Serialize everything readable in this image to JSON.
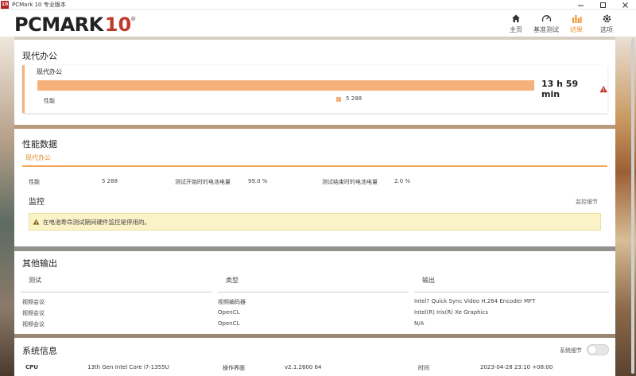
{
  "window": {
    "app_logo": "10",
    "title": "PCMark 10 专业版本",
    "min_icon": "minimize-icon",
    "max_icon": "maximize-icon",
    "close_icon": "close-icon"
  },
  "brand": {
    "name": "PCMARK",
    "number": "10",
    "reg": "®"
  },
  "nav": [
    {
      "label": "主页",
      "icon": "home-icon",
      "active": false
    },
    {
      "label": "基准测试",
      "icon": "gauge-icon",
      "active": false
    },
    {
      "label": "结果",
      "icon": "bar-chart-icon",
      "active": true
    },
    {
      "label": "选项",
      "icon": "gear-icon",
      "active": false
    }
  ],
  "colors": {
    "accent": "#f09a3e",
    "bar": "#f6b07a",
    "warning_red": "#c0392b",
    "alert_bg": "#fbf3c8"
  },
  "result": {
    "section_title": "现代办公",
    "name": "现代办公",
    "duration": "13 h 59 min",
    "perf_label": "性能",
    "perf_value": "5 288"
  },
  "performance": {
    "section_title": "性能数据",
    "tab": "现代办公",
    "items": [
      {
        "label": "性能",
        "value": "5 288"
      },
      {
        "label": "测试开始时的电池电量",
        "value": "99.0 %"
      },
      {
        "label": "测试结束时的电池电量",
        "value": "2.0 %"
      }
    ],
    "monitor_title": "监控",
    "monitor_link": "监控细节",
    "alert": "在电池寿命测试期间硬件监控是停用的。"
  },
  "other": {
    "section_title": "其他输出",
    "headers": [
      "测试",
      "类型",
      "输出"
    ],
    "rows": [
      [
        "视频会议",
        "视频编码器",
        "Intel? Quick Sync Video H.264 Encoder MFT"
      ],
      [
        "视频会议",
        "OpenCL",
        "Intel(R) Iris(R) Xe Graphics"
      ],
      [
        "视频会议",
        "OpenCL",
        "N/A"
      ]
    ]
  },
  "sysinfo": {
    "section_title": "系统信息",
    "detail_label": "系统细节",
    "detail_on": false,
    "cpu_label": "CPU",
    "cpu_value": "13th Gen Intel Core i7-1355U",
    "os_label": "操作界面",
    "os_value": "v2.1.2600 64",
    "time_label": "时间",
    "time_value": "2023-04-28 23:10 +08:00"
  }
}
